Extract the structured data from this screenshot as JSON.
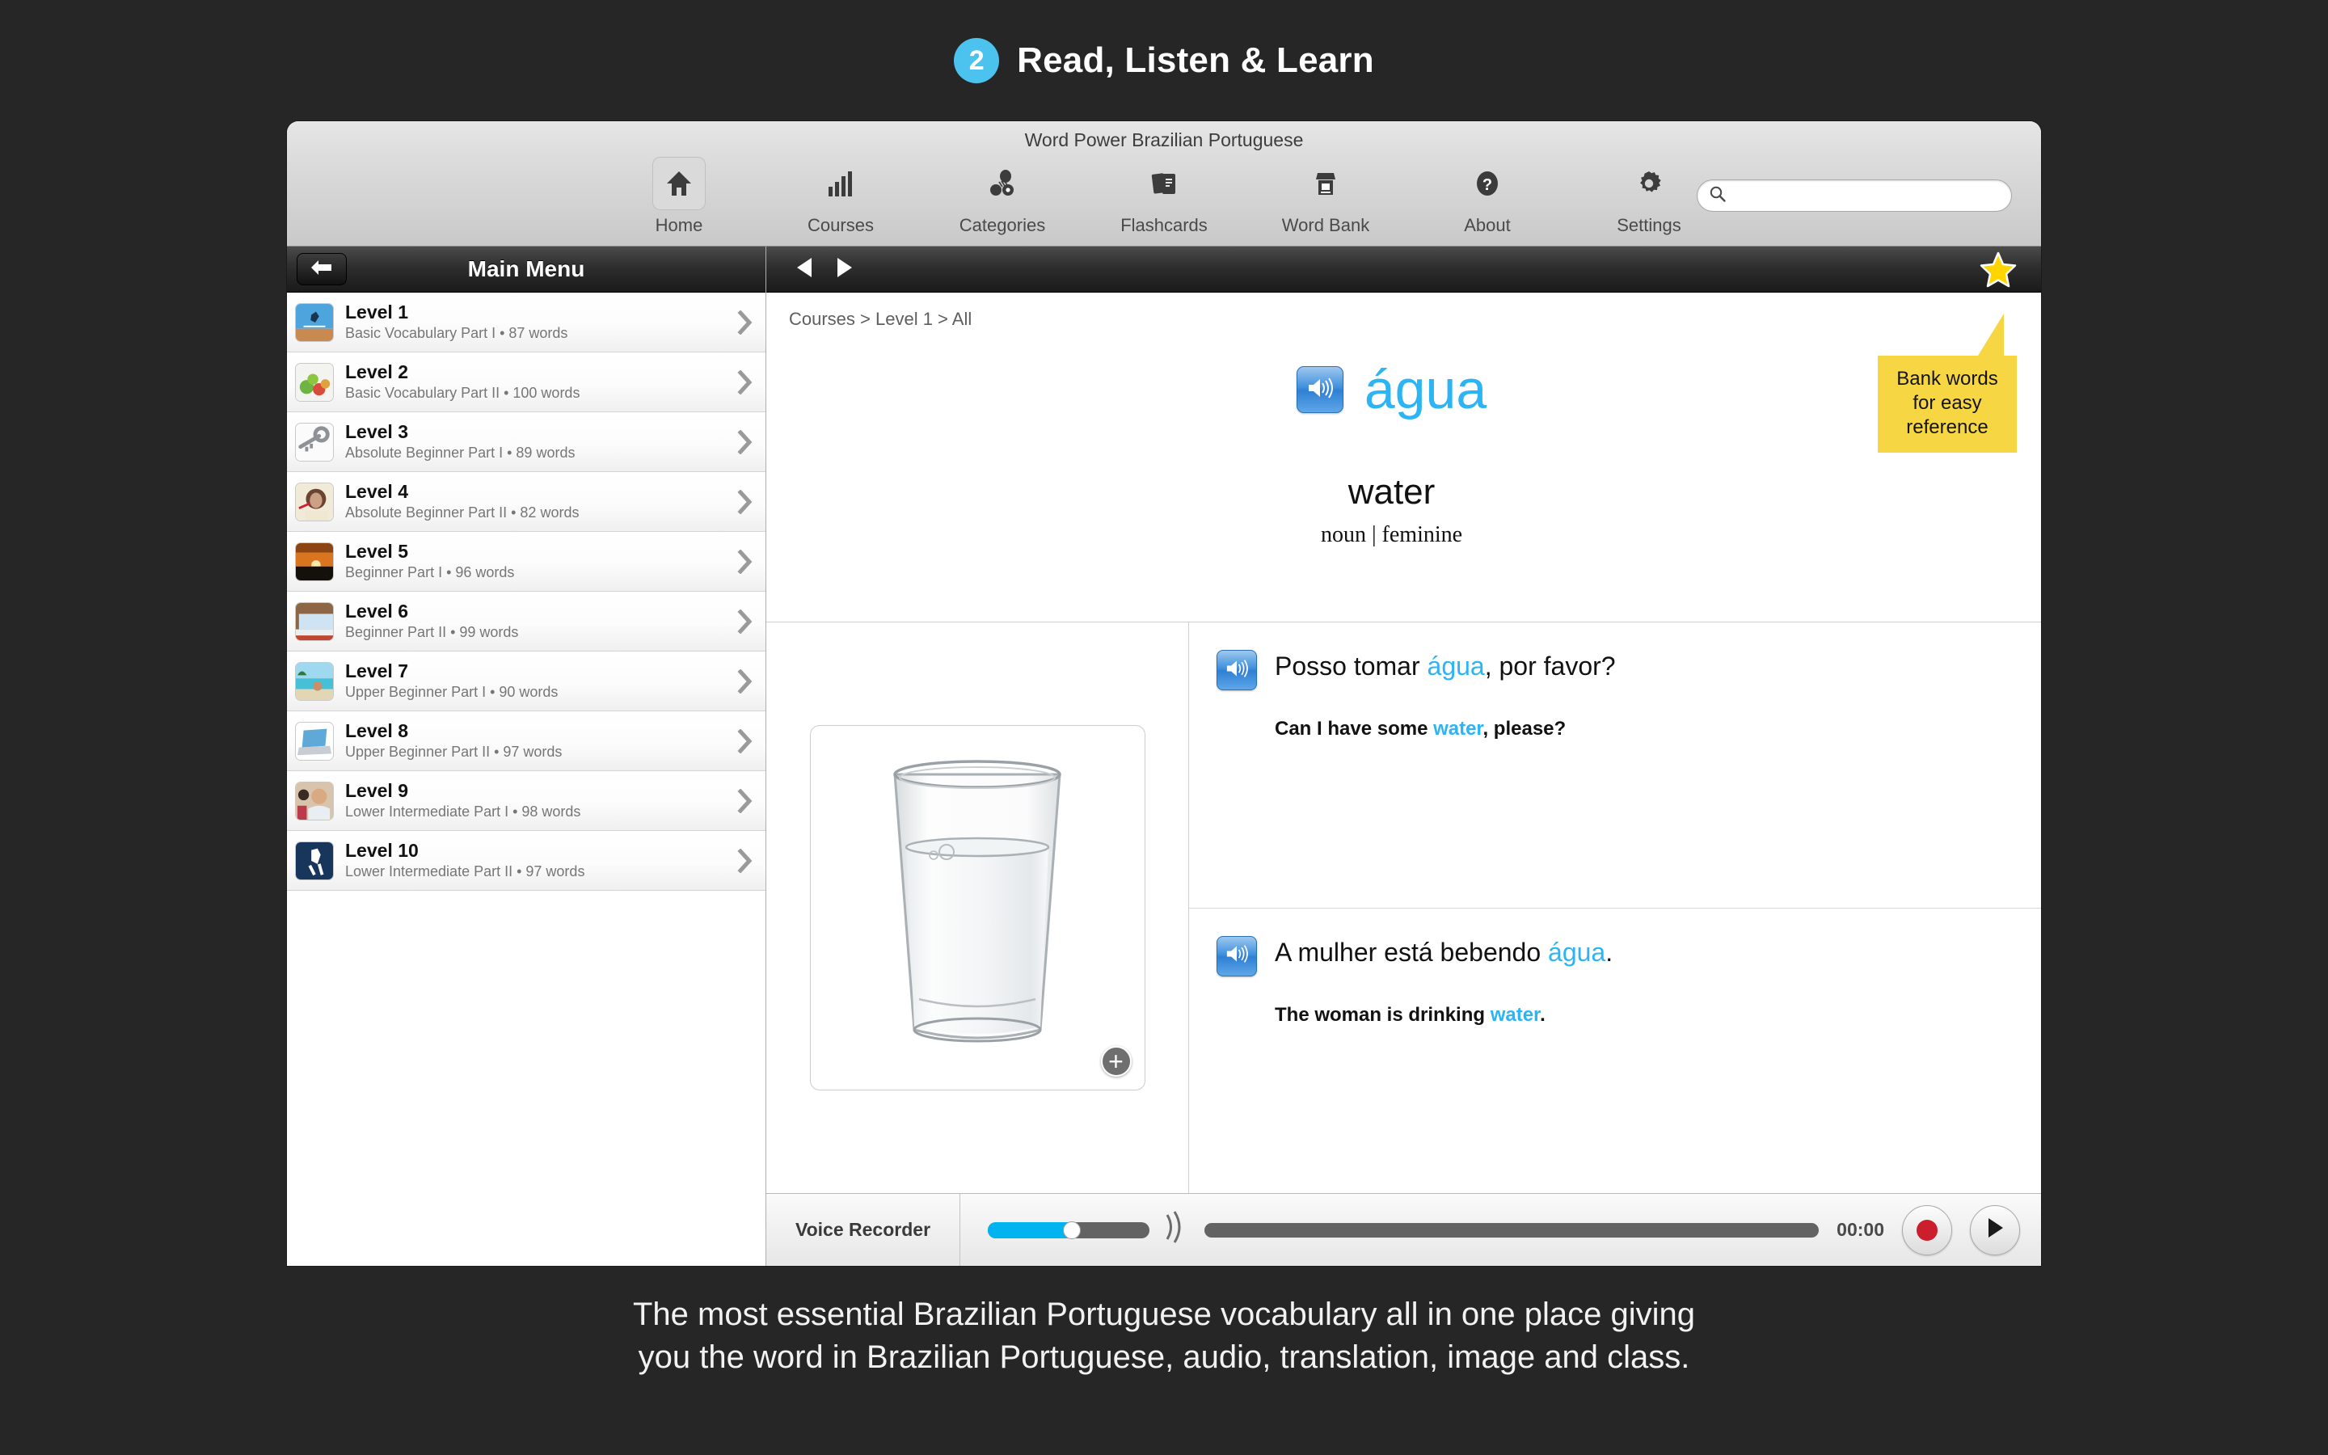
{
  "promo": {
    "step_number": "2",
    "headline": "Read, Listen & Learn",
    "caption_line1": "The most essential Brazilian Portuguese vocabulary all in one place giving",
    "caption_line2": "you the word in Brazilian Portuguese, audio, translation, image and class."
  },
  "window": {
    "title": "Word Power Brazilian Portuguese"
  },
  "toolbar": {
    "items": [
      {
        "label": "Home",
        "icon": "home-icon",
        "active": true
      },
      {
        "label": "Courses",
        "icon": "bar-chart-icon",
        "active": false
      },
      {
        "label": "Categories",
        "icon": "categories-icon",
        "active": false
      },
      {
        "label": "Flashcards",
        "icon": "flashcards-icon",
        "active": false
      },
      {
        "label": "Word Bank",
        "icon": "word-bank-icon",
        "active": false
      },
      {
        "label": "About",
        "icon": "question-mark-icon",
        "active": false
      },
      {
        "label": "Settings",
        "icon": "gear-icon",
        "active": false
      }
    ],
    "search_placeholder": "",
    "search_value": ""
  },
  "sidebar": {
    "title": "Main Menu",
    "back_label": "Back",
    "levels": [
      {
        "name": "Level 1",
        "subtitle": "Basic Vocabulary Part I • 87 words",
        "thumb": "hurdle-jumper"
      },
      {
        "name": "Level 2",
        "subtitle": "Basic Vocabulary Part II • 100 words",
        "thumb": "vegetables"
      },
      {
        "name": "Level 3",
        "subtitle": "Absolute Beginner Part I • 89 words",
        "thumb": "keys"
      },
      {
        "name": "Level 4",
        "subtitle": "Absolute Beginner Part II • 82 words",
        "thumb": "woman-toothbrush"
      },
      {
        "name": "Level 5",
        "subtitle": "Beginner Part I • 96 words",
        "thumb": "sunset"
      },
      {
        "name": "Level 6",
        "subtitle": "Beginner Part II • 99 words",
        "thumb": "bed-blanket"
      },
      {
        "name": "Level 7",
        "subtitle": "Upper Beginner Part I • 90 words",
        "thumb": "beach-hammock"
      },
      {
        "name": "Level 8",
        "subtitle": "Upper Beginner Part II • 97 words",
        "thumb": "laptop"
      },
      {
        "name": "Level 9",
        "subtitle": "Lower Intermediate Part I • 98 words",
        "thumb": "man-classroom"
      },
      {
        "name": "Level 10",
        "subtitle": "Lower Intermediate Part II • 97 words",
        "thumb": "runner"
      }
    ]
  },
  "content": {
    "breadcrumb": "Courses > Level 1 > All",
    "headword": "água",
    "translation": "water",
    "word_class": "noun | feminine",
    "callout": "Bank words for easy reference",
    "image_alt": "glass-of-water",
    "sentences": [
      {
        "target_pre": "Posso tomar ",
        "target_highlight": "água",
        "target_post": ", por favor?",
        "native_pre": "Can I have some ",
        "native_highlight": "water",
        "native_post": ", please?"
      },
      {
        "target_pre": "A mulher está bebendo ",
        "target_highlight": "água",
        "target_post": ".",
        "native_pre": "The woman is drinking ",
        "native_highlight": "water",
        "native_post": "."
      }
    ]
  },
  "recorder": {
    "label": "Voice Recorder",
    "time": "00:00",
    "volume_percent": 52,
    "record_label": "Record",
    "play_label": "Play"
  },
  "colors": {
    "accent_blue": "#2cb4f5",
    "promo_badge": "#4cc3ef",
    "callout_yellow": "#f7d644",
    "record_red": "#cc1f2e",
    "volume_fill": "#01b3ef"
  }
}
